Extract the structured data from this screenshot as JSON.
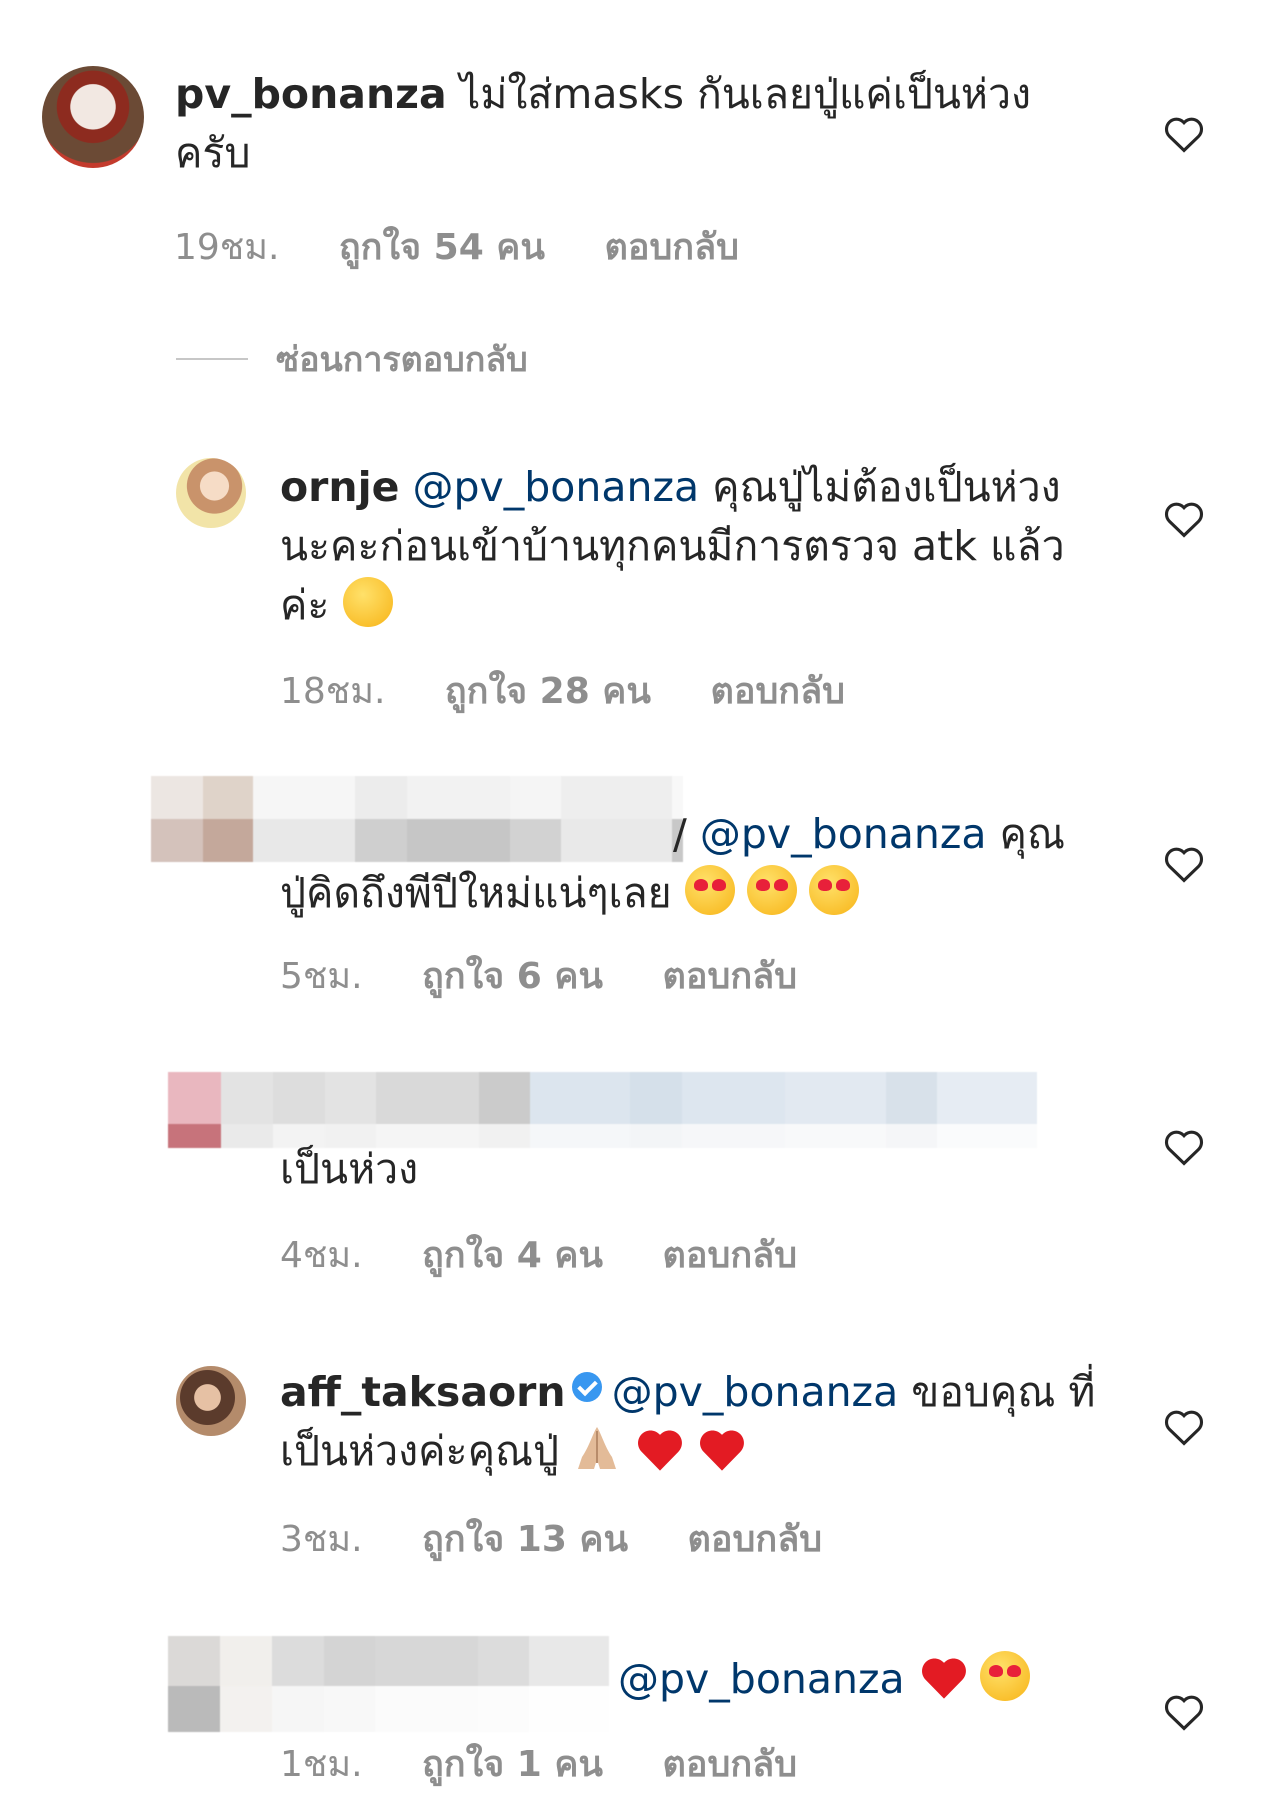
{
  "comments": [
    {
      "username": "pv_bonanza",
      "text": " ไม่ใส่masks กันเลยปู่แค่เป็นห่วง ครับ",
      "time": "19ชม.",
      "likes": "ถูกใจ 54 คน",
      "reply": "ตอบกลับ"
    },
    {
      "username": "ornje",
      "mention": "@pv_bonanza",
      "text": " คุณปู่ไม่ต้องเป็นห่วง นะคะก่อนเข้าบ้านทุกคนมีการตรวจ atk แล้ว ค่ะ",
      "time": "18ชม.",
      "likes": "ถูกใจ 28 คน",
      "reply": "ตอบกลับ"
    },
    {
      "username_partial": "/",
      "mention": "@pv_bonanza",
      "text": " คุณ ปู่คิดถึงพีปีใหม่แน่ๆเลย",
      "time": "5ชม.",
      "likes": "ถูกใจ 6 คน",
      "reply": "ตอบกลับ"
    },
    {
      "text": "เป็นห่วง",
      "time": "4ชม.",
      "likes": "ถูกใจ 4 คน",
      "reply": "ตอบกลับ"
    },
    {
      "username": "aff_taksaorn",
      "mention": "@pv_bonanza",
      "text": " ขอบคุณ ที่เป็นห่วงค่ะคุณปู่",
      "time": "3ชม.",
      "likes": "ถูกใจ 13 คน",
      "reply": "ตอบกลับ"
    },
    {
      "mention": "@pv_bonanza",
      "time": "1ชม.",
      "likes": "ถูกใจ 1 คน",
      "reply": "ตอบกลับ"
    }
  ],
  "hide_replies": "ซ่อนการตอบกลับ",
  "colors": {
    "mention": "#00376b",
    "meta": "#8e8e8e",
    "text": "#262626",
    "verified": "#3897f0"
  },
  "icons": [
    "heart-icon",
    "verified-badge-icon"
  ]
}
